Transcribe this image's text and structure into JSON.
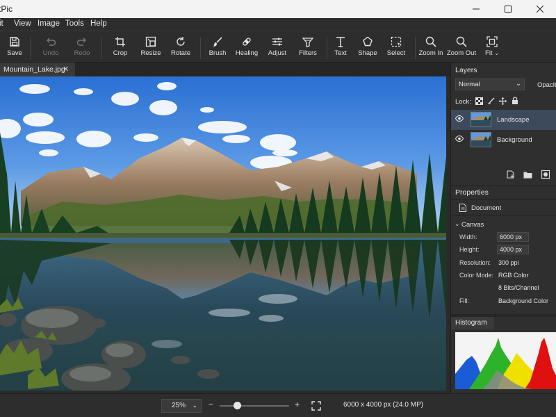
{
  "window": {
    "title": "tPic"
  },
  "menubar": {
    "items": [
      "it",
      "View",
      "Image",
      "Tools",
      "Help"
    ]
  },
  "toolbar": {
    "tools": [
      {
        "label": "Save",
        "icon": "save-icon"
      },
      {
        "label": "Undo",
        "icon": "undo-icon"
      },
      {
        "label": "Redo",
        "icon": "redo-icon"
      },
      {
        "label": "Crop",
        "icon": "crop-icon"
      },
      {
        "label": "Resize",
        "icon": "resize-icon"
      },
      {
        "label": "Rotate",
        "icon": "rotate-icon"
      },
      {
        "label": "Brush",
        "icon": "brush-icon"
      },
      {
        "label": "Healing",
        "icon": "healing-icon"
      },
      {
        "label": "Adjust",
        "icon": "adjust-icon"
      },
      {
        "label": "Filters",
        "icon": "filters-icon"
      },
      {
        "label": "Text",
        "icon": "text-icon"
      },
      {
        "label": "Shape",
        "icon": "shape-icon"
      },
      {
        "label": "Select",
        "icon": "select-icon"
      },
      {
        "label": "Zoom In",
        "icon": "zoom-in-icon"
      },
      {
        "label": "Zoom Out",
        "icon": "zoom-out-icon"
      },
      {
        "label": "Fit",
        "icon": "fit-icon"
      }
    ]
  },
  "document_tab": {
    "name": "Mountain_Lake.jpg",
    "close": "✕"
  },
  "layers_panel": {
    "title": "Layers",
    "blend_mode": "Normal",
    "opacity_label": "Opacity",
    "lock_label": "Lock:",
    "layers": [
      {
        "name": "Landscape",
        "selected": true
      },
      {
        "name": "Background",
        "selected": false
      }
    ]
  },
  "properties_panel": {
    "title": "Properties",
    "document_label": "Document",
    "section": "Canvas",
    "width_label": "Width:",
    "width_value": "6000 px",
    "height_label": "Height:",
    "height_value": "4000 px",
    "resolution_label": "Resolution:",
    "resolution_value": "300 ppi",
    "color_mode_label": "Color Mode:",
    "color_mode_value": "RGB Color",
    "bit_depth_value": "8 Bits/Channel",
    "fill_label": "Fill:",
    "fill_value": "Background Color"
  },
  "histogram_panel": {
    "title": "Histogram"
  },
  "statusbar": {
    "zoom": "25%",
    "zoom_slider_value": 0.25,
    "minus": "−",
    "plus": "+",
    "image_info": "6000 x 4000 px (24.0 MP)"
  },
  "colors": {
    "accent_selection": "#3d4a5c",
    "panel_bg": "#2f2f2f",
    "toolbar_bg": "#2d2d2d"
  }
}
